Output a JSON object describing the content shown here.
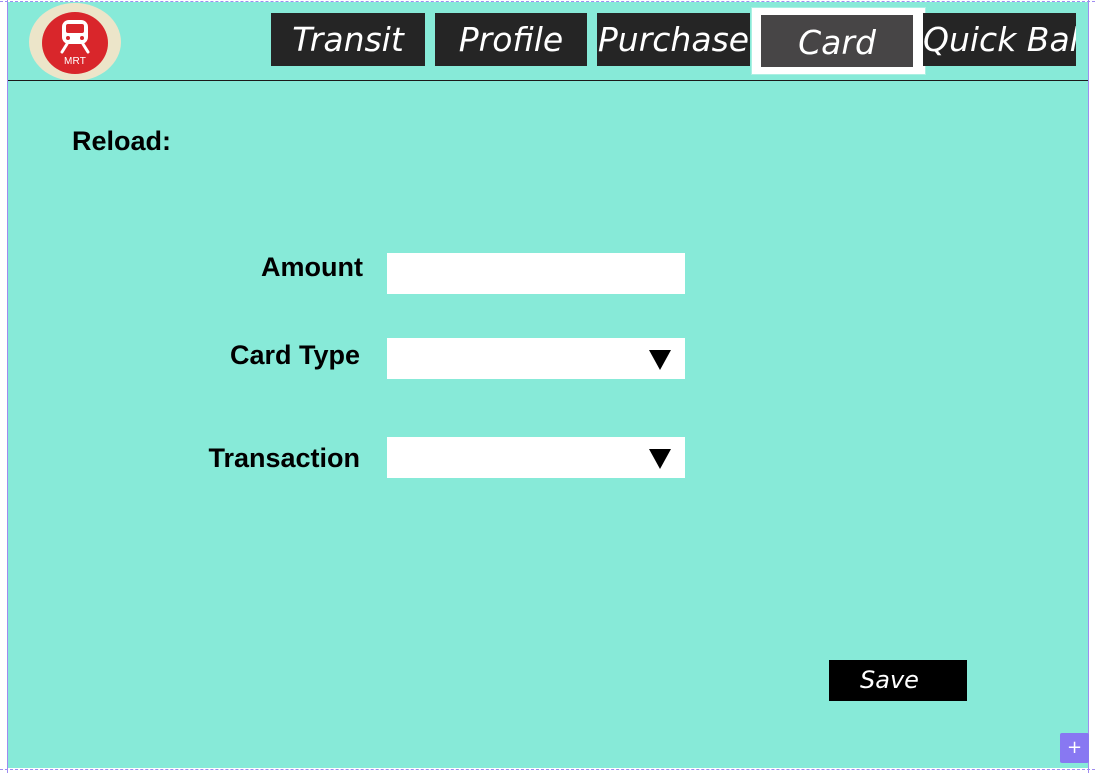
{
  "logo": {
    "text": "MRT",
    "badge_color": "#d9262b",
    "ring_color": "#ece5c9",
    "icon": "train-icon"
  },
  "nav": {
    "tabs": [
      {
        "label": "Transit",
        "active": false
      },
      {
        "label": "Profile",
        "active": false
      },
      {
        "label": "Purchase",
        "active": false
      },
      {
        "label": "Card",
        "active": true
      },
      {
        "label": "Quick Bal.",
        "active": false
      }
    ]
  },
  "form": {
    "section_title": "Reload:",
    "amount": {
      "label": "Amount",
      "value": "",
      "placeholder": ""
    },
    "card_type": {
      "label": "Card Type",
      "value": ""
    },
    "transaction": {
      "label": "Transaction",
      "value": ""
    },
    "save_label": "Save"
  },
  "colors": {
    "background": "#87ead8",
    "tab": "#252525",
    "tab_active": "#474546",
    "button": "#000000",
    "editor_accent": "#8878f2"
  },
  "editor": {
    "corner_handle_symbol": "+"
  }
}
